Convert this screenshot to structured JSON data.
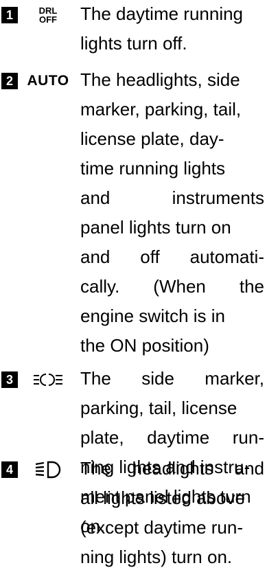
{
  "items": [
    {
      "number": "1",
      "symbol_icon": "drl-off-switch-icon",
      "symbol_top": "DRL",
      "symbol_bottom": "OFF",
      "lines": [
        "The daytime running",
        "lights turn off."
      ]
    },
    {
      "number": "2",
      "symbol_icon": "auto-switch-icon",
      "symbol_text": "AUTO",
      "lines": [
        "The headlights, side",
        "marker, parking, tail,",
        "license plate, day-",
        "time running lights",
        "and instruments",
        "panel lights turn on",
        "and off automati-",
        "cally. (When the",
        "engine switch is in",
        "the ON position)"
      ]
    },
    {
      "number": "3",
      "symbol_icon": "side-marker-lights-icon",
      "lines": [
        "The side marker,",
        "parking, tail, license",
        "plate, daytime run-",
        "ning lights and instru-",
        "ment panel lights turn",
        "on."
      ]
    },
    {
      "number": "4",
      "symbol_icon": "headlights-icon",
      "lines": [
        "The headlights and",
        "all lights listed above",
        "(except daytime run-",
        "ning lights) turn on."
      ]
    }
  ]
}
